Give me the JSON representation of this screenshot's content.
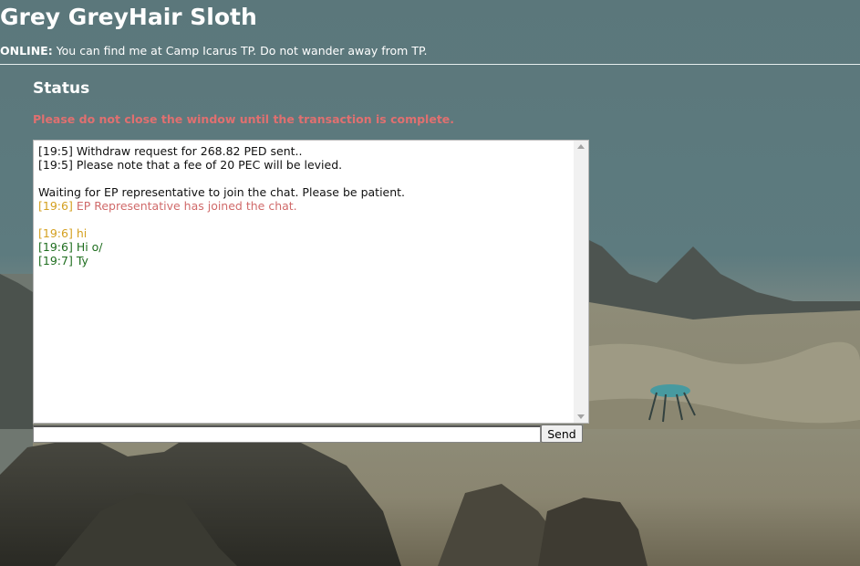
{
  "header": {
    "title": "Grey GreyHair Sloth",
    "status_label": "ONLINE:",
    "status_text": "You can find me at Camp Icarus TP. Do not wander away from TP."
  },
  "status": {
    "heading": "Status",
    "warning": "Please do not close the window until the transaction is complete."
  },
  "chat": {
    "messages": [
      {
        "time": "[19:5]",
        "text": "Withdraw request for 268.82 PED sent..",
        "kind": "system"
      },
      {
        "time": "[19:5]",
        "text": "Please note that a fee of 20 PEC will be levied.",
        "kind": "system"
      },
      {
        "text": "Waiting for EP representative to join the chat. Please be patient.",
        "kind": "system"
      },
      {
        "time": "[19:6]",
        "text": "EP Representative has joined the chat.",
        "kind": "rep"
      },
      {
        "time": "[19:6]",
        "text": "hi",
        "kind": "user"
      },
      {
        "time": "[19:6]",
        "text": "Hi o/",
        "kind": "agent"
      },
      {
        "time": "[19:7]",
        "text": "Ty",
        "kind": "agent"
      }
    ]
  },
  "input": {
    "value": "",
    "send_label": "Send"
  },
  "colors": {
    "sky": "#5a7478",
    "warning": "#e07070",
    "rep": "#d06a6a",
    "user_timestamp": "#d4a020",
    "agent": "#1f6e1f"
  }
}
